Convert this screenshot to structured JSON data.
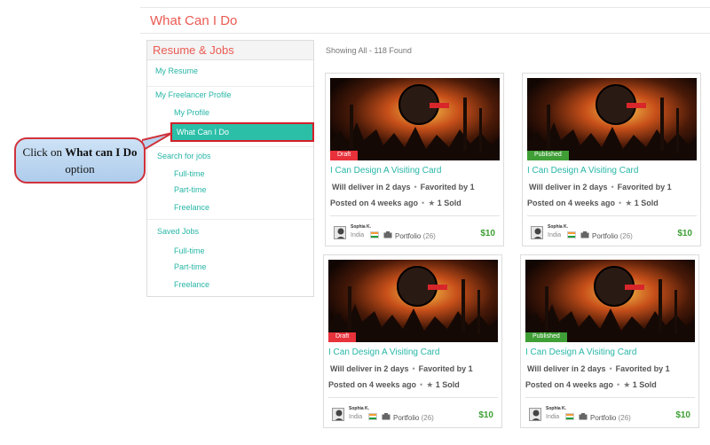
{
  "page": {
    "title": "What Can I Do"
  },
  "sidebar": {
    "header": "Resume & Jobs",
    "my_resume": "My Resume",
    "freelancer_profile": "My Freelancer Profile",
    "my_profile": "My Profile",
    "what_can_i_do": "What Can I Do",
    "search_for_jobs": "Search for jobs",
    "search_full_time": "Full-time",
    "search_part_time": "Part-time",
    "search_freelance": "Freelance",
    "saved_jobs": "Saved Jobs",
    "saved_full_time": "Full-time",
    "saved_part_time": "Part-time",
    "saved_freelance": "Freelance"
  },
  "callout": {
    "prefix": "Click on ",
    "bold": "What can I Do",
    "suffix": " option"
  },
  "results": {
    "showing": "Showing All - 118 Found"
  },
  "cards": [
    {
      "status": "Draft",
      "title": "I Can Design A Visiting Card",
      "deliver": "Will deliver in 2 days",
      "favorited": "Favorited by 1",
      "posted": "Posted on 4 weeks ago",
      "sold": "1 Sold",
      "seller": "Sophia K.",
      "country": "India",
      "portfolio": "Portfolio",
      "portfolio_count": "(26)",
      "price": "$10"
    },
    {
      "status": "Published",
      "title": "I Can Design A Visiting Card",
      "deliver": "Will deliver in 2 days",
      "favorited": "Favorited by 1",
      "posted": "Posted on 4 weeks ago",
      "sold": "1 Sold",
      "seller": "Sophia K.",
      "country": "India",
      "portfolio": "Portfolio",
      "portfolio_count": "(26)",
      "price": "$10"
    },
    {
      "status": "Draft",
      "title": "I Can Design A Visiting Card",
      "deliver": "Will deliver in 2 days",
      "favorited": "Favorited by 1",
      "posted": "Posted on 4 weeks ago",
      "sold": "1 Sold",
      "seller": "Sophia K.",
      "country": "India",
      "portfolio": "Portfolio",
      "portfolio_count": "(26)",
      "price": "$10"
    },
    {
      "status": "Published",
      "title": "I Can Design A Visiting Card",
      "deliver": "Will deliver in 2 days",
      "favorited": "Favorited by 1",
      "posted": "Posted on 4 weeks ago",
      "sold": "1 Sold",
      "seller": "Sophia K.",
      "country": "India",
      "portfolio": "Portfolio",
      "portfolio_count": "(26)",
      "price": "$10"
    }
  ],
  "icons": {
    "star": "star-icon",
    "folder": "portfolio-folder-icon",
    "flag": "india-flag-icon"
  },
  "colors": {
    "accent": "#27b6a6",
    "title": "#ea5a52",
    "draft": "#e8313a",
    "published": "#3f9f36",
    "price": "#3c9f33"
  }
}
